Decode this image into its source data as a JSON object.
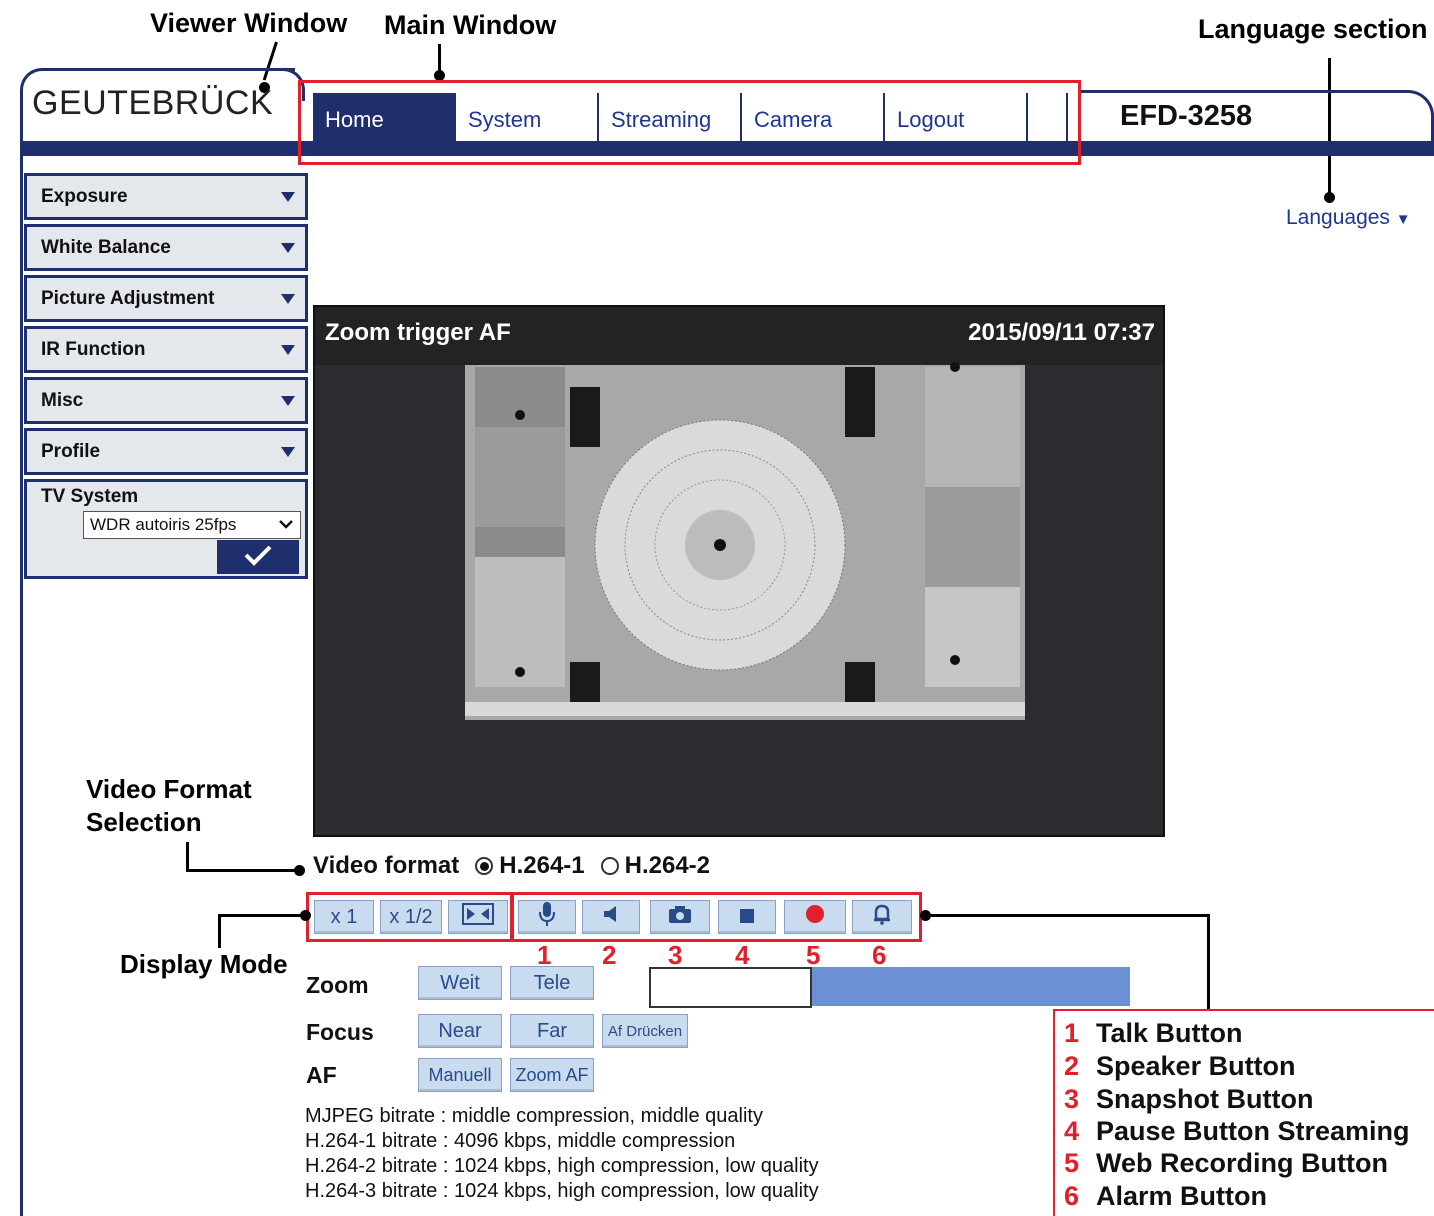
{
  "callouts": {
    "viewer_window": "Viewer Window",
    "main_window": "Main Window",
    "language_section": "Language section",
    "video_format_selection_1": "Video Format",
    "video_format_selection_2": "Selection",
    "display_mode": "Display Mode"
  },
  "header": {
    "logo": "GEUTEBRÜCK",
    "model": "EFD-3258",
    "tabs": [
      "Home",
      "System",
      "Streaming",
      "Camera",
      "Logout"
    ],
    "active_tab": "Home",
    "languages": "Languages"
  },
  "sidebar": {
    "items": [
      "Exposure",
      "White Balance",
      "Picture Adjustment",
      "IR Function",
      "Misc",
      "Profile"
    ],
    "tv_system_label": "TV System",
    "tv_system_value": "WDR autoiris 25fps"
  },
  "video": {
    "title": "Zoom trigger AF",
    "timestamp": "2015/09/11 07:37"
  },
  "video_format": {
    "label": "Video format",
    "options": [
      "H.264-1",
      "H.264-2"
    ],
    "selected": "H.264-1"
  },
  "display_mode": {
    "buttons": [
      "x 1",
      "x 1/2"
    ]
  },
  "control_numbers": [
    "1",
    "2",
    "3",
    "4",
    "5",
    "6"
  ],
  "controls": {
    "zoom_label": "Zoom",
    "zoom_wide": "Weit",
    "zoom_tele": "Tele",
    "focus_label": "Focus",
    "focus_near": "Near",
    "focus_far": "Far",
    "focus_af_press": "Af Drücken",
    "af_label": "AF",
    "af_manual": "Manuell",
    "af_zoom": "Zoom AF",
    "zoom_level_fraction": 0.33
  },
  "bitrates": [
    "MJPEG bitrate : middle compression, middle quality",
    "H.264-1 bitrate : 4096 kbps, middle compression",
    "H.264-2 bitrate : 1024 kbps, high compression, low quality",
    "H.264-3 bitrate : 1024 kbps, high compression, low quality"
  ],
  "legend": [
    {
      "n": "1",
      "label": "Talk Button"
    },
    {
      "n": "2",
      "label": "Speaker Button"
    },
    {
      "n": "3",
      "label": "Snapshot Button"
    },
    {
      "n": "4",
      "label": "Pause Button Streaming"
    },
    {
      "n": "5",
      "label": "Web Recording Button"
    },
    {
      "n": "6",
      "label": "Alarm Button"
    }
  ],
  "colors": {
    "navy": "#1f2f6e",
    "link_blue": "#1f3690",
    "annotation_red": "#e0202a",
    "button_blue": "#c9dbef",
    "zoom_bar_blue": "#6b90d4"
  }
}
